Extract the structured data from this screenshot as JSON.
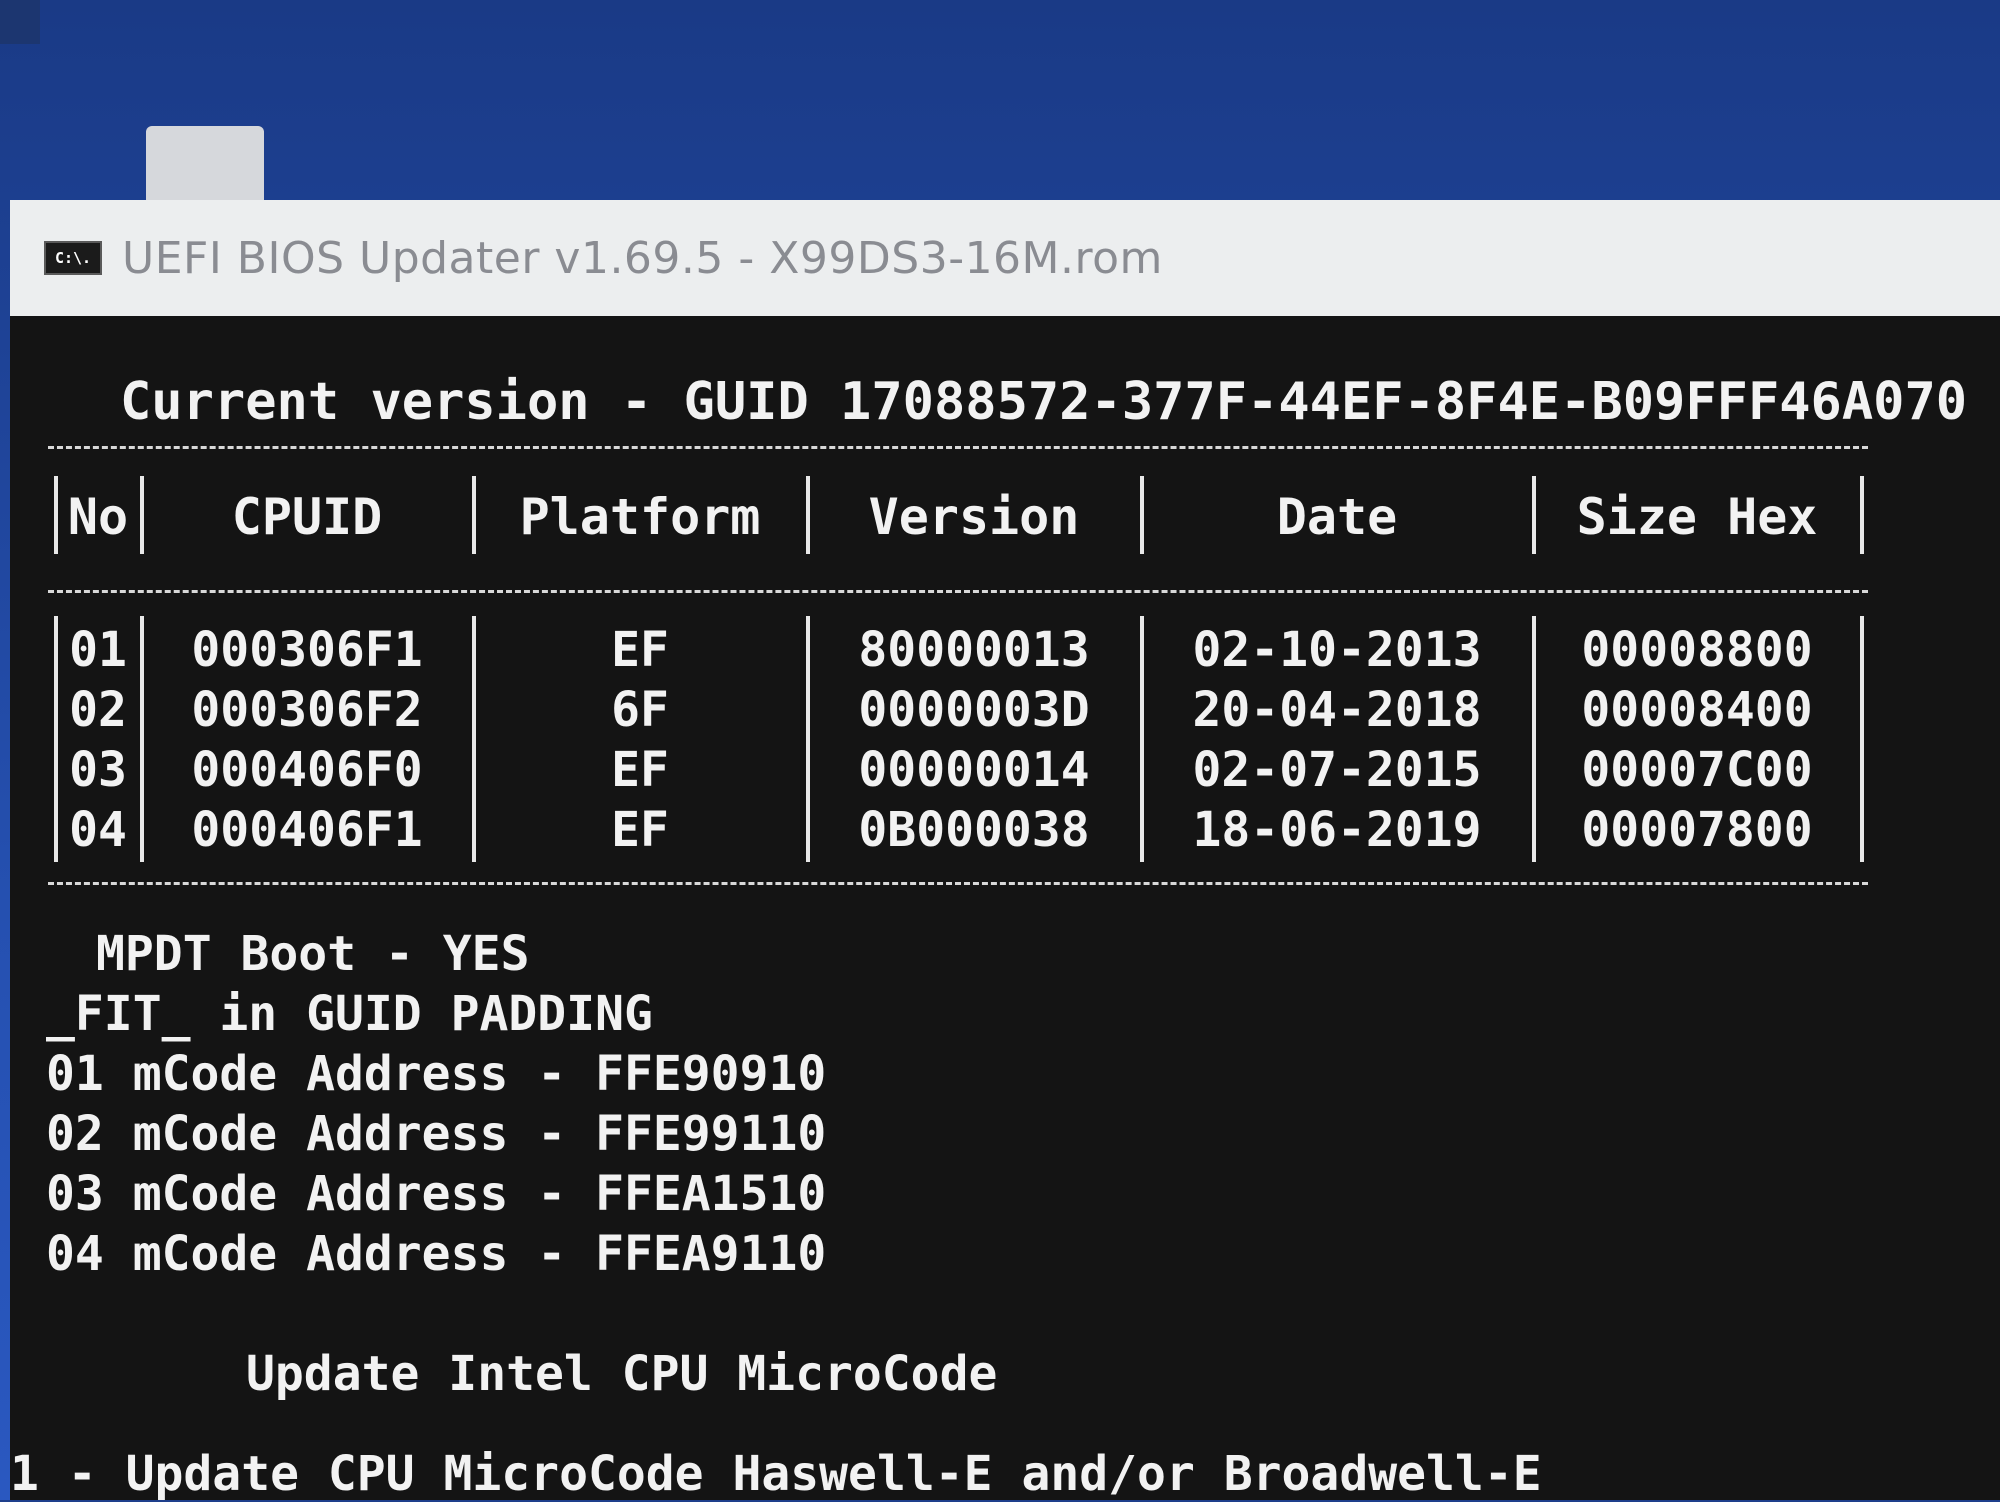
{
  "window": {
    "title": "UEFI BIOS Updater v1.69.5 - X99DS3-16M.rom",
    "icon_label": "C:\\."
  },
  "console": {
    "current_version": "Current version - GUID 17088572-377F-44EF-8F4E-B09FFF46A070",
    "table": {
      "headers": [
        "No",
        "CPUID",
        "Platform",
        "Version",
        "Date",
        "Size Hex"
      ],
      "rows": [
        [
          "01",
          "000306F1",
          "EF",
          "80000013",
          "02-10-2013",
          "00008800"
        ],
        [
          "02",
          "000306F2",
          "6F",
          "0000003D",
          "20-04-2018",
          "00008400"
        ],
        [
          "03",
          "000406F0",
          "EF",
          "00000014",
          "02-07-2015",
          "00007C00"
        ],
        [
          "04",
          "000406F1",
          "EF",
          "0B000038",
          "18-06-2019",
          "00007800"
        ]
      ]
    },
    "mpdt_boot": "MPDT Boot - YES",
    "fit_line": "_FIT_ in GUID PADDING",
    "mcode_lines": [
      "01 mCode Address - FFE90910",
      "02 mCode Address - FFE99110",
      "03 mCode Address - FFEA1510",
      "04 mCode Address - FFEA9110"
    ],
    "section_title": "Update Intel CPU MicroCode",
    "option_1": "1 - Update CPU MicroCode Haswell-E and/or Broadwell-E"
  }
}
